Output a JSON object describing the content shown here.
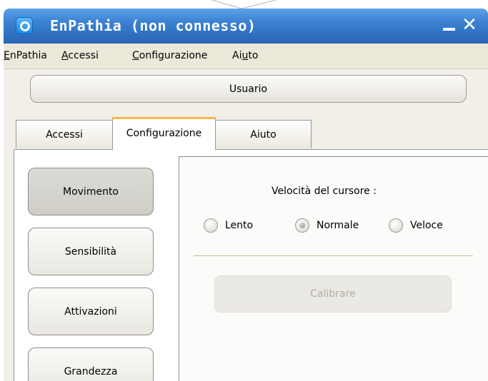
{
  "window": {
    "title": "EnPathia (non connesso)",
    "minimize_glyph": "—",
    "close_glyph": "✕",
    "title_bar_color": "#3e84d4"
  },
  "menu": [
    {
      "underline": "E",
      "rest": "nPathia"
    },
    {
      "underline": "A",
      "rest": "ccessi"
    },
    {
      "underline": "C",
      "rest": "onfigurazione"
    },
    {
      "pre": "Ai",
      "underline": "u",
      "rest": "to"
    }
  ],
  "user_button": {
    "label": "Usuario"
  },
  "tabs": [
    {
      "label": "Accessi",
      "active": false
    },
    {
      "label": "Configurazione",
      "active": true
    },
    {
      "label": "Aiuto",
      "active": false
    }
  ],
  "side_buttons": [
    {
      "label": "Movimento",
      "selected": true
    },
    {
      "label": "Sensibilità",
      "selected": false
    },
    {
      "label": "Attivazioni",
      "selected": false
    },
    {
      "label": "Grandezza",
      "selected": false
    }
  ],
  "cursor_speed": {
    "label": "Velocità del cursore :",
    "options": [
      {
        "label": "Lento",
        "checked": false
      },
      {
        "label": "Normale",
        "checked": true
      },
      {
        "label": "Veloce",
        "checked": false
      }
    ]
  },
  "calibrate_button": {
    "label": "Calibrare",
    "enabled": false
  },
  "colors": {
    "accent_tab": "#f7b64a",
    "divider": "#c8b79a"
  }
}
